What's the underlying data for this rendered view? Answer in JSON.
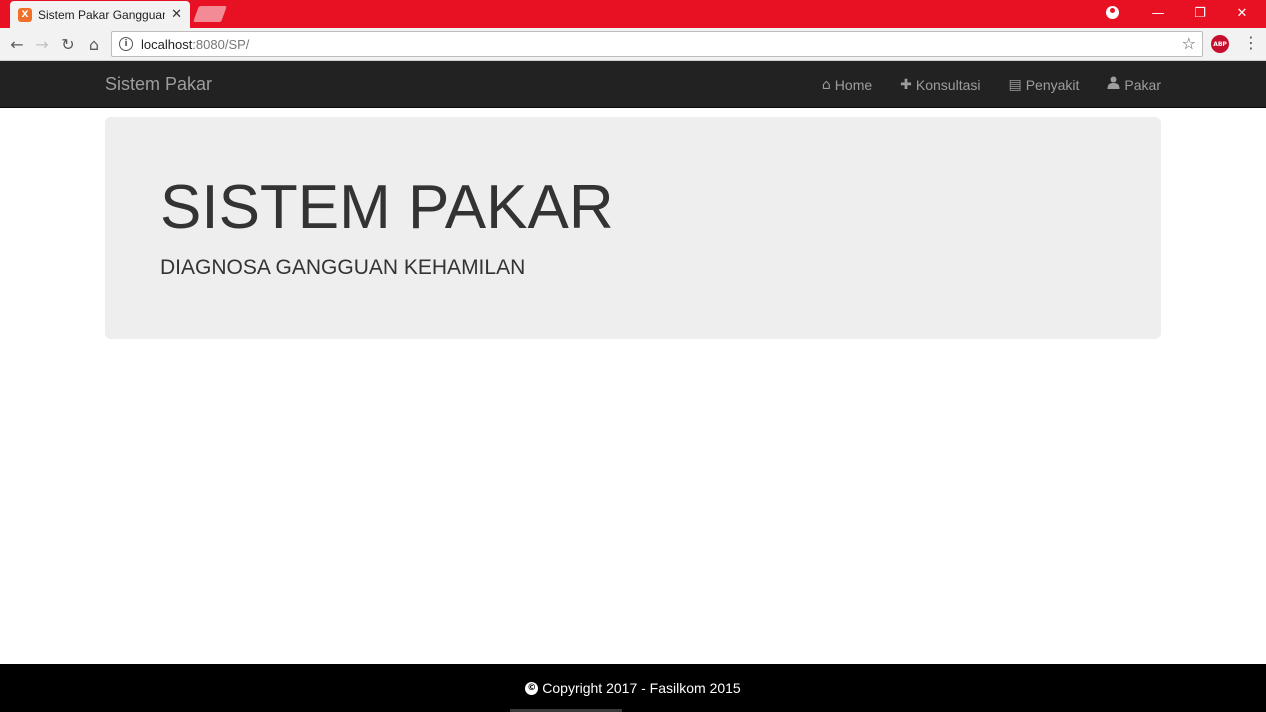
{
  "browser": {
    "tab_title": "Sistem Pakar Gangguan K",
    "tab_favicon_text": "X",
    "url_host": "localhost",
    "url_path": ":8080/SP/",
    "abp_label": "ABP",
    "theme_color": "#e81123"
  },
  "icons": {
    "back": "←",
    "forward": "→",
    "reload": "↻",
    "home": "⌂",
    "info": "i",
    "star": "☆",
    "menu": "⋮",
    "close": "✕",
    "minimize": "—",
    "restore": "❐",
    "copyright": "©"
  },
  "navbar": {
    "brand": "Sistem Pakar",
    "items": [
      {
        "label": "Home",
        "icon": "⌂",
        "icon_name": "home-icon"
      },
      {
        "label": "Konsultasi",
        "icon": "✚",
        "icon_name": "plus-icon"
      },
      {
        "label": "Penyakit",
        "icon": "▤",
        "icon_name": "list-icon"
      },
      {
        "label": "Pakar",
        "icon": "👤",
        "icon_name": "user-icon"
      }
    ]
  },
  "jumbotron": {
    "title": "SISTEM PAKAR",
    "subtitle": "DIAGNOSA GANGGUAN KEHAMILAN"
  },
  "footer": {
    "text": "Copyright 2017 - Fasilkom 2015"
  }
}
